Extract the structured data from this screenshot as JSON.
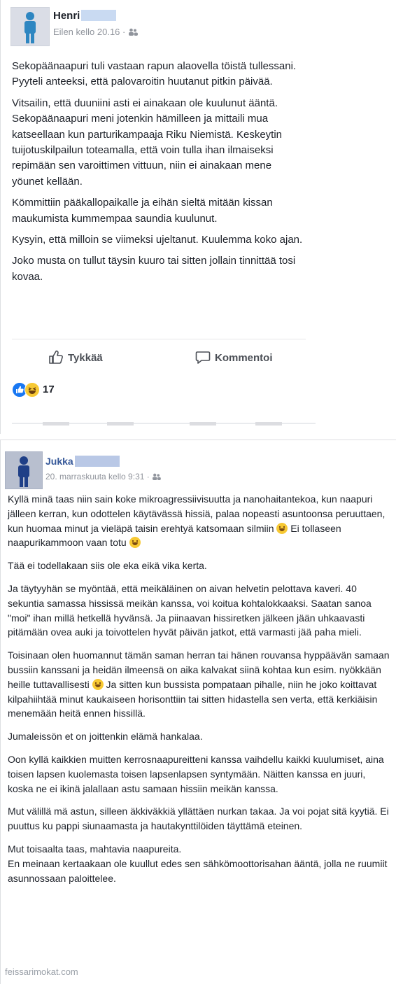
{
  "post1": {
    "author": "Henri",
    "timestamp": "Eilen kello 20.16",
    "paragraphs": [
      "Sekopäänaapuri tuli vastaan rapun alaovella töistä tullessani. Pyyteli anteeksi, että palovaroitin huutanut pitkin päivää.",
      "Vitsailin, että duuniini asti ei ainakaan ole kuulunut ääntä. Sekopäänaapuri meni jotenkin hämilleen ja mittaili mua katseellaan kun parturikampaaja Riku Niemistä. Keskeytin tuijotuskilpailun toteamalla, että voin tulla ihan ilmaiseksi repimään sen varoittimen vittuun, niin ei ainakaan mene yöunet kellään.",
      "Kömmittiin pääkallopaikalle ja eihän sieltä mitään kissan maukumista kummempaa saundia kuulunut.",
      "Kysyin, että milloin se viimeksi ujeltanut. Kuulemma koko ajan.",
      "Joko musta on tullut täysin kuuro tai sitten jollain tinnittää tosi kovaa."
    ],
    "like_label": "Tykkää",
    "comment_label": "Kommentoi",
    "reaction_count": "17"
  },
  "post2": {
    "author": "Jukka",
    "timestamp": "20. marraskuuta kello 9:31",
    "p1a": "Kyllä minä taas niin sain koke mikroagressiivisuutta ja nanohaitantekoa, kun naapuri jälleen kerran, kun odottelen käytävässä hissiä, palaa nopeasti asuntoonsa peruuttaen, kun huomaa minut ja vieläpä taisin erehtyä katsomaan silmiin",
    "p1b": " Ei tollaseen naapurikammoon vaan totu",
    "p2": "Tää ei todellakaan siis ole eka eikä vika kerta.",
    "p3": "Ja täytyyhän se myöntää, että meikäläinen on aivan helvetin pelottava kaveri. 40 sekuntia samassa hississä meikän kanssa, voi koitua kohtalokkaaksi. Saatan sanoa \"moi\" ihan millä hetkellä hyvänsä. Ja piinaavan hissiretken jälkeen jään uhkaavasti pitämään ovea auki ja toivottelen hyvät päivän jatkot, että varmasti jää paha mieli.",
    "p4a": "Toisinaan olen huomannut tämän saman herran tai hänen rouvansa hyppäävän samaan bussiin kanssani ja heidän ilmeensä on aika kalvakat siinä kohtaa kun esim. nyökkään heille tuttavallisesti",
    "p4b": " Ja sitten kun bussista pompataan pihalle, niin he joko koittavat kilpahiihtää minut kaukaiseen horisonttiin tai sitten hidastella sen verta, että kerkiäisin menemään heitä ennen hissillä.",
    "p5": "Jumaleissön et on joittenkin elämä hankalaa.",
    "p6": "Oon kyllä kaikkien muitten kerrosnaapureitteni kanssa vaihdellu kaikki kuulumiset, aina toisen lapsen kuolemasta toisen lapsenlapsen syntymään. Näitten kanssa en juuri, koska ne ei ikinä jalallaan astu samaan hissiin meikän kanssa.",
    "p7": "Mut välillä mä astun, silleen äkkiväkkiä yllättäen nurkan takaa. Ja voi pojat sitä kyytiä. Ei puuttus ku pappi siunaamasta ja hautakynttilöiden täyttämä eteinen.",
    "p8a": "Mut toisaalta taas, mahtavia naapureita.",
    "p8b": "En meinaan kertaakaan ole kuullut edes sen sähkömoottorisahan ääntä, jolla ne ruumiit asunnossaan paloittelee."
  },
  "watermark": "feissarimokat.com",
  "colors": {
    "link_blue": "#365899",
    "meta_gray": "#90949c",
    "like_blue": "#1877f2",
    "haha_yellow": "#f7c934"
  }
}
